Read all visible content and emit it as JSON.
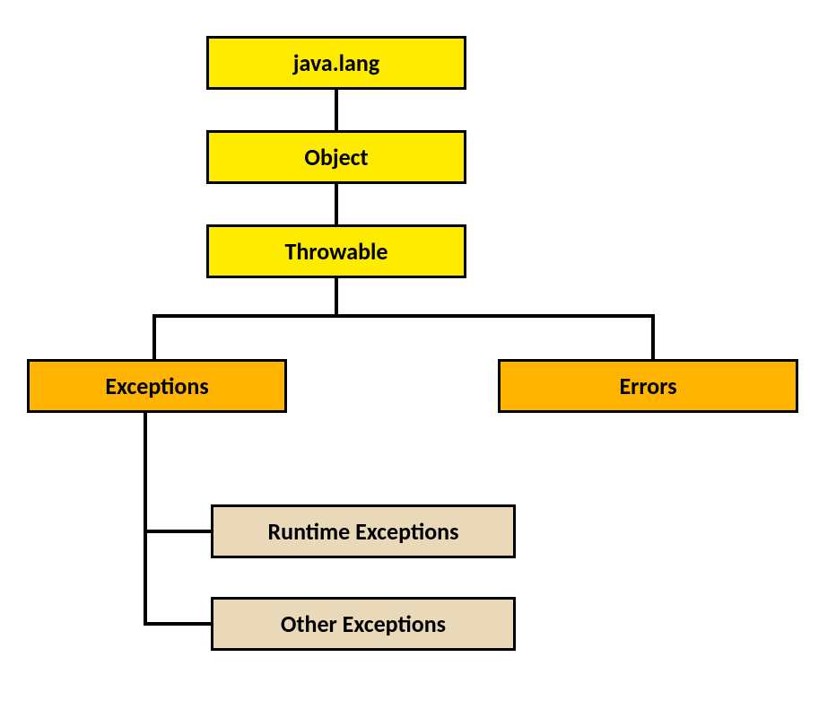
{
  "nodes": {
    "javalang": "java.lang",
    "object": "Object",
    "throwable": "Throwable",
    "exceptions": "Exceptions",
    "errors": "Errors",
    "runtime": "Runtime Exceptions",
    "other": "Other Exceptions"
  }
}
